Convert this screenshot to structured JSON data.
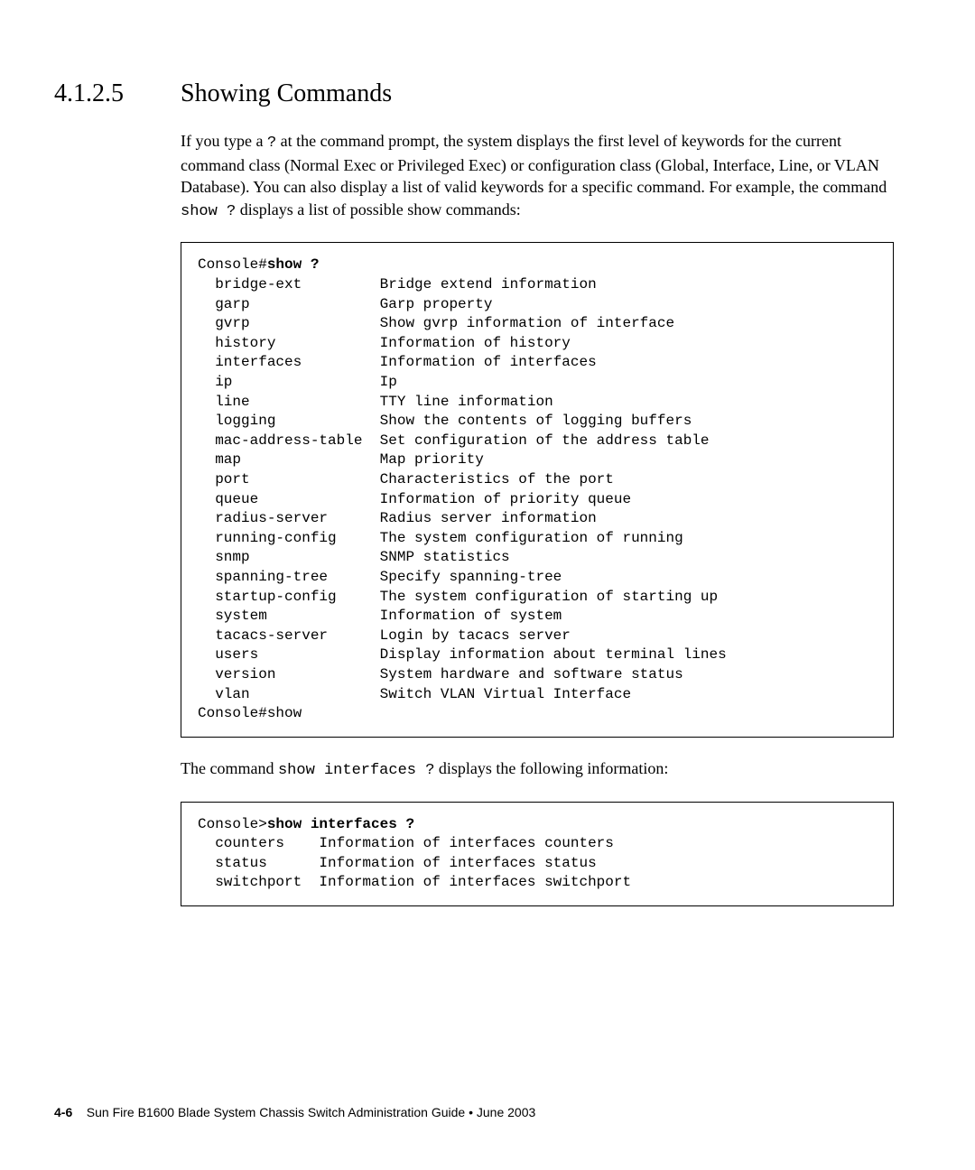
{
  "section": {
    "number": "4.1.2.5",
    "title": "Showing Commands"
  },
  "paragraph1": {
    "t1": "If you type a ",
    "q1": "?",
    "t2": " at the command prompt, the system displays the first level of keywords for the current command class (Normal Exec or Privileged Exec) or configuration class (Global, Interface, Line, or VLAN Database). You can also display a list of valid keywords for a specific command. For example, the command ",
    "cmd": "show ?",
    "t3": " displays a list of possible show commands:"
  },
  "codeblock1": {
    "prompt_pre": "Console#",
    "prompt_cmd": "show ?",
    "items": [
      {
        "k": "bridge-ext",
        "d": "Bridge extend information"
      },
      {
        "k": "garp",
        "d": "Garp property"
      },
      {
        "k": "gvrp",
        "d": "Show gvrp information of interface"
      },
      {
        "k": "history",
        "d": "Information of history"
      },
      {
        "k": "interfaces",
        "d": "Information of interfaces"
      },
      {
        "k": "ip",
        "d": "Ip"
      },
      {
        "k": "line",
        "d": "TTY line information"
      },
      {
        "k": "logging",
        "d": "Show the contents of logging buffers"
      },
      {
        "k": "mac-address-table",
        "d": "Set configuration of the address table"
      },
      {
        "k": "map",
        "d": "Map priority"
      },
      {
        "k": "port",
        "d": "Characteristics of the port"
      },
      {
        "k": "queue",
        "d": "Information of priority queue"
      },
      {
        "k": "radius-server",
        "d": "Radius server information"
      },
      {
        "k": "running-config",
        "d": "The system configuration of running"
      },
      {
        "k": "snmp",
        "d": "SNMP statistics"
      },
      {
        "k": "spanning-tree",
        "d": "Specify spanning-tree"
      },
      {
        "k": "startup-config",
        "d": "The system configuration of starting up"
      },
      {
        "k": "system",
        "d": "Information of system"
      },
      {
        "k": "tacacs-server",
        "d": "Login by tacacs server"
      },
      {
        "k": "users",
        "d": "Display information about terminal lines"
      },
      {
        "k": "version",
        "d": "System hardware and software status"
      },
      {
        "k": "vlan",
        "d": "Switch VLAN Virtual Interface"
      }
    ],
    "trailer": "Console#show"
  },
  "paragraph2": {
    "t1": "The command ",
    "cmd": "show interfaces ?",
    "t2": " displays the following information:"
  },
  "codeblock2": {
    "prompt_pre": "Console>",
    "prompt_cmd": "show interfaces ?",
    "items": [
      {
        "k": "counters",
        "d": "Information of interfaces counters"
      },
      {
        "k": "status",
        "d": "Information of interfaces status"
      },
      {
        "k": "switchport",
        "d": "Information of interfaces switchport"
      }
    ]
  },
  "footer": {
    "page_num": "4-6",
    "text": "Sun Fire B1600 Blade System Chassis Switch Administration Guide • June 2003"
  }
}
